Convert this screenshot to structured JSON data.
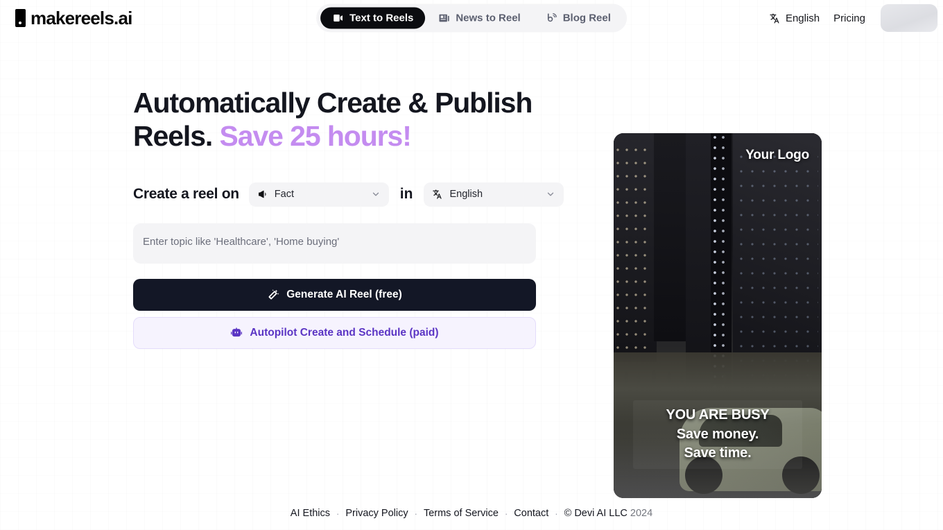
{
  "brand": {
    "name": "makereels.ai",
    "mark_icon": "door-mark-icon"
  },
  "header": {
    "tabs": [
      {
        "label": "Text to Reels",
        "icon": "video-camera-icon",
        "active": true
      },
      {
        "label": "News to Reel",
        "icon": "newspaper-icon",
        "active": false
      },
      {
        "label": "Blog Reel",
        "icon": "blogger-signal-icon",
        "active": false
      }
    ],
    "language": {
      "label": "English",
      "icon": "translate-icon"
    },
    "pricing_label": "Pricing",
    "account_placeholder": ""
  },
  "hero": {
    "headline_part1": "Automatically Create & Publish Reels.",
    "headline_accent": "Save 25 hours!",
    "accent_color": "#c48cf0"
  },
  "form": {
    "prefix_label": "Create a reel on",
    "type_select": {
      "value": "Fact",
      "icon": "megaphone-icon",
      "chevron": "chevron-down-icon"
    },
    "connector_label": "in",
    "language_select": {
      "value": "English",
      "icon": "translate-icon",
      "chevron": "chevron-down-icon"
    },
    "topic_placeholder": "Enter topic like 'Healthcare', 'Home buying'",
    "topic_value": "",
    "generate_button": {
      "label": "Generate AI Reel (free)",
      "icon": "magic-wand-icon"
    },
    "autopilot_button": {
      "label": "Autopilot Create and Schedule (paid)",
      "icon": "robot-icon"
    }
  },
  "preview": {
    "logo_overlay": "Your Logo",
    "caption_line1": "YOU ARE BUSY",
    "caption_line2": "Save money.",
    "caption_line3": "Save time."
  },
  "footer": {
    "links": [
      "AI Ethics",
      "Privacy Policy",
      "Terms of Service",
      "Contact"
    ],
    "separator": "·",
    "copyright": "© Devi AI LLC",
    "year": "2024"
  }
}
